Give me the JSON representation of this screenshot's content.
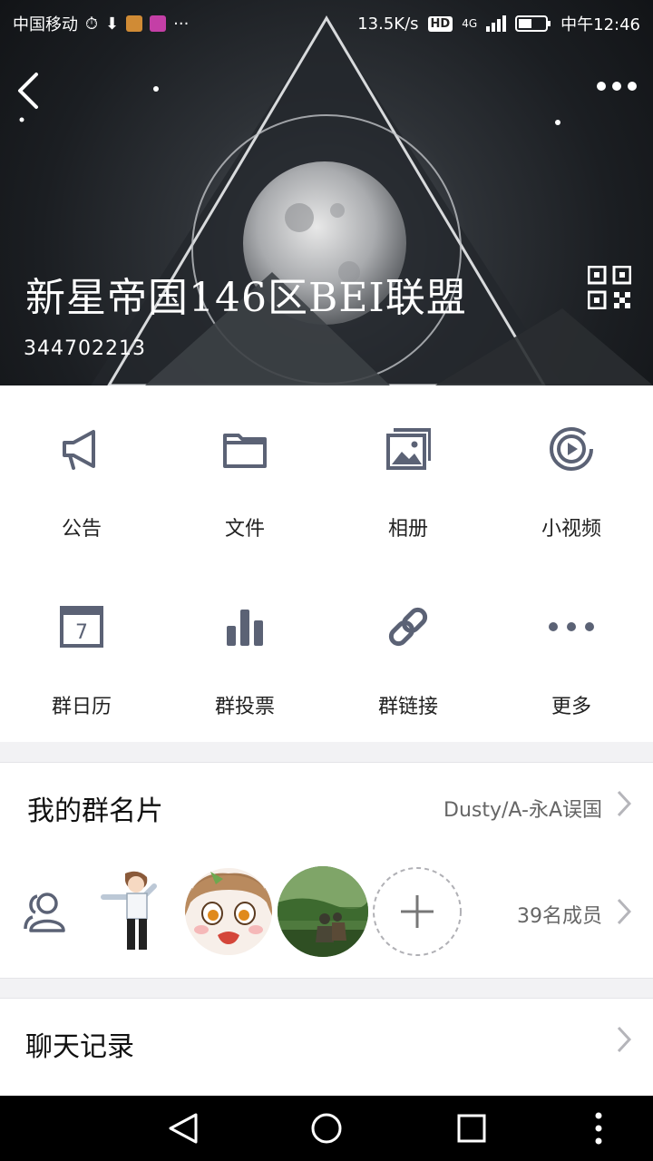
{
  "status_bar": {
    "carrier": "中国移动",
    "speed": "13.5K/s",
    "network": "4G",
    "time": "中午12:46"
  },
  "header": {
    "group_name": "新星帝国146区BEI联盟",
    "group_id": "344702213"
  },
  "features": [
    {
      "label": "公告",
      "icon": "megaphone-icon"
    },
    {
      "label": "文件",
      "icon": "folder-icon"
    },
    {
      "label": "相册",
      "icon": "album-icon"
    },
    {
      "label": "小视频",
      "icon": "video-icon"
    },
    {
      "label": "群日历",
      "icon": "calendar-icon"
    },
    {
      "label": "群投票",
      "icon": "vote-icon"
    },
    {
      "label": "群链接",
      "icon": "link-icon"
    },
    {
      "label": "更多",
      "icon": "more-icon"
    }
  ],
  "calendar_day": "7",
  "my_card": {
    "title": "我的群名片",
    "value": "Dusty/A-永A误国"
  },
  "members": {
    "count_text": "39名成员"
  },
  "chat_history": {
    "title": "聊天记录"
  },
  "colors": {
    "icon": "#5b6275",
    "divider": "#e4e4e8"
  }
}
